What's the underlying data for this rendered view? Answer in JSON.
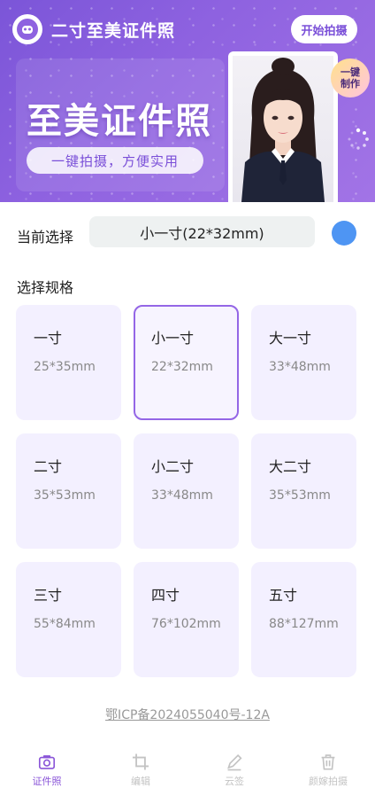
{
  "header": {
    "app_title": "二寸至美证件照",
    "start_button": "开始拍摄"
  },
  "hero": {
    "title": "至美证件照",
    "subtitle": "一键拍摄，方便实用",
    "badge": "一键\n制作"
  },
  "current": {
    "label": "当前选择",
    "value": "小一寸(22*32mm)",
    "color": "#4e95f3"
  },
  "specs": {
    "title": "选择规格",
    "items": [
      {
        "name": "一寸",
        "size": "25*35mm"
      },
      {
        "name": "小一寸",
        "size": "22*32mm"
      },
      {
        "name": "大一寸",
        "size": "33*48mm"
      },
      {
        "name": "二寸",
        "size": "35*53mm"
      },
      {
        "name": "小二寸",
        "size": "33*48mm"
      },
      {
        "name": "大二寸",
        "size": "35*53mm"
      },
      {
        "name": "三寸",
        "size": "55*84mm"
      },
      {
        "name": "四寸",
        "size": "76*102mm"
      },
      {
        "name": "五寸",
        "size": "88*127mm"
      }
    ],
    "selected_index": 1
  },
  "footer": {
    "icp": "鄂ICP备2024055040号-12A"
  },
  "tabs": [
    {
      "label": "证件照",
      "icon": "camera-icon"
    },
    {
      "label": "编辑",
      "icon": "crop-icon"
    },
    {
      "label": "云签",
      "icon": "pen-icon"
    },
    {
      "label": "颜嫁拍摄",
      "icon": "trash-icon"
    }
  ],
  "colors": {
    "accent": "#8a55d8",
    "hero_start": "#7b55d8",
    "card_bg": "#f3f0ff",
    "selected_border": "#9466e6"
  }
}
